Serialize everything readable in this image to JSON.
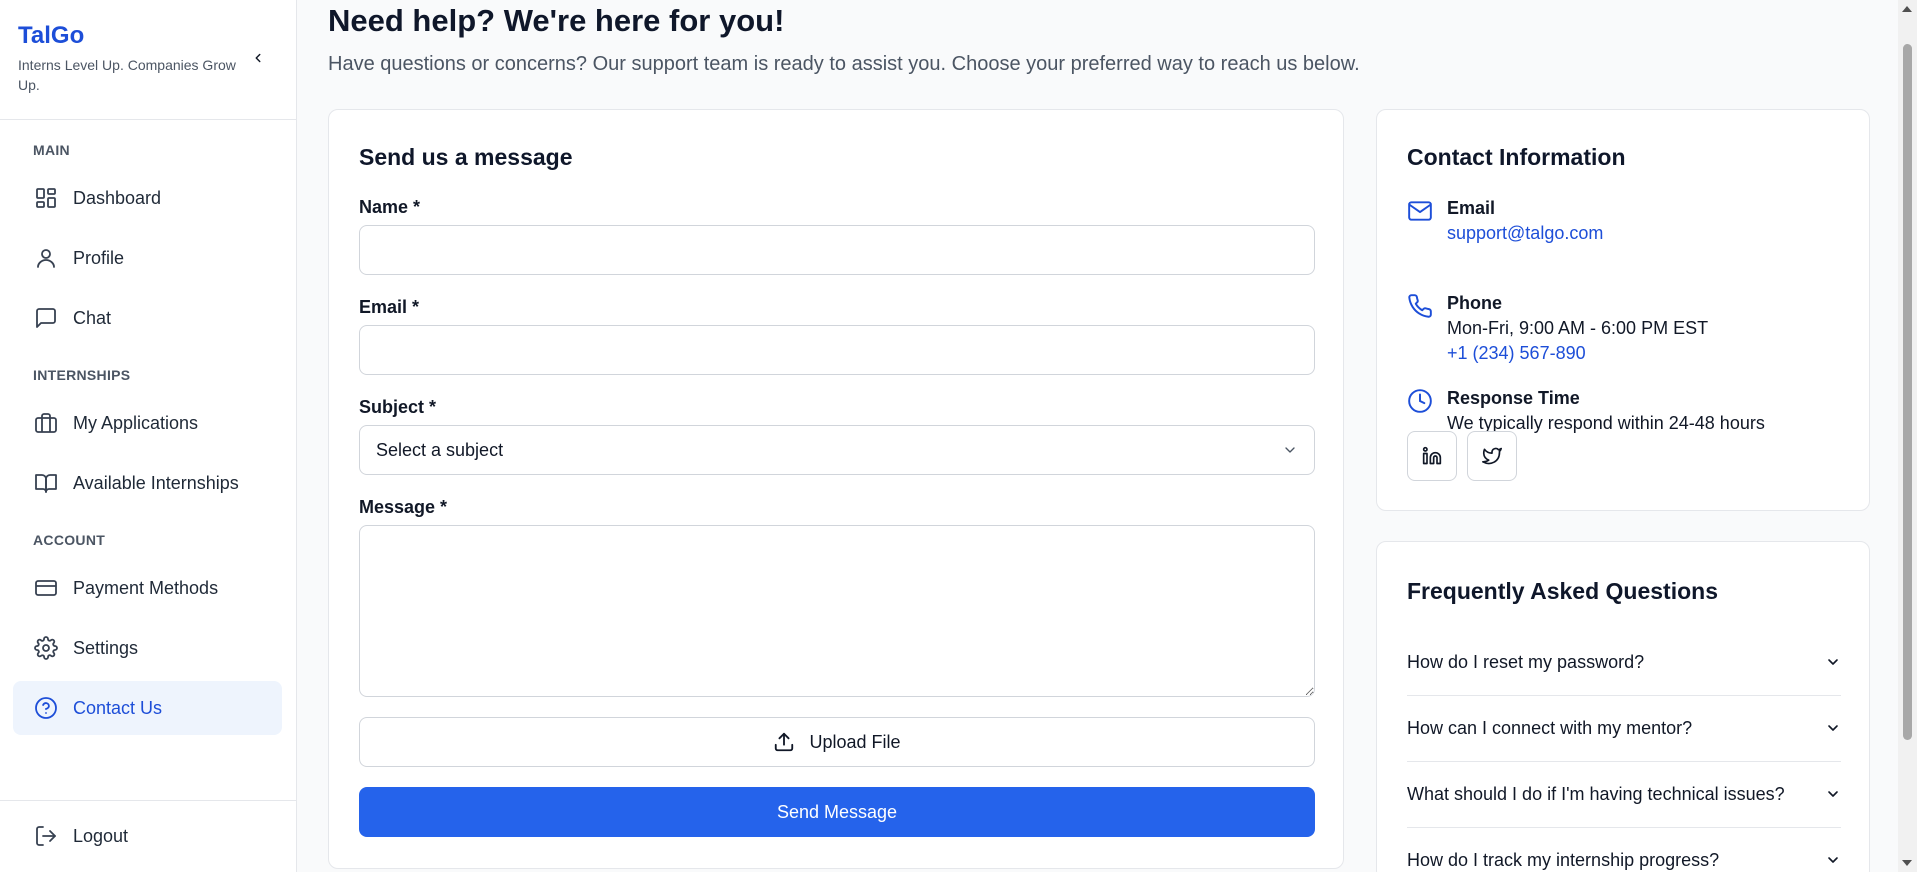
{
  "brand": {
    "title": "TalGo",
    "tagline": "Interns Level Up. Companies Grow Up."
  },
  "sidebar": {
    "sections": [
      "MAIN",
      "INTERNSHIPS",
      "ACCOUNT"
    ],
    "items": [
      {
        "label": "Dashboard",
        "icon": "dashboard-icon"
      },
      {
        "label": "Profile",
        "icon": "user-icon"
      },
      {
        "label": "Chat",
        "icon": "chat-icon"
      },
      {
        "label": "My Applications",
        "icon": "briefcase-icon"
      },
      {
        "label": "Available Internships",
        "icon": "book-icon"
      },
      {
        "label": "Payment Methods",
        "icon": "credit-card-icon"
      },
      {
        "label": "Settings",
        "icon": "gear-icon"
      },
      {
        "label": "Contact Us",
        "icon": "help-circle-icon",
        "active": true
      }
    ],
    "logout": "Logout"
  },
  "header": {
    "title": "Need help? We're here for you!",
    "subtitle": "Have questions or concerns? Our support team is ready to assist you. Choose your preferred way to reach us below."
  },
  "form": {
    "title": "Send us a message",
    "name_label": "Name *",
    "name_value": "",
    "email_label": "Email *",
    "email_value": "",
    "subject_label": "Subject *",
    "subject_selected": "Select a subject",
    "message_label": "Message *",
    "message_value": "",
    "upload_label": "Upload File",
    "send_label": "Send Message"
  },
  "contact": {
    "title": "Contact Information",
    "email_head": "Email",
    "email_value": "support@talgo.com",
    "phone_head": "Phone",
    "phone_hours": "Mon-Fri, 9:00 AM - 6:00 PM EST",
    "phone_value": "+1 (234) 567-890",
    "response_head": "Response Time",
    "response_text": "We typically respond within 24-48 hours"
  },
  "faq": {
    "title": "Frequently Asked Questions",
    "items": [
      "How do I reset my password?",
      "How can I connect with my mentor?",
      "What should I do if I'm having technical issues?",
      "How do I track my internship progress?"
    ]
  },
  "colors": {
    "accent": "#2563eb",
    "link": "#1d4ed8",
    "active_bg": "#eef4fd"
  }
}
